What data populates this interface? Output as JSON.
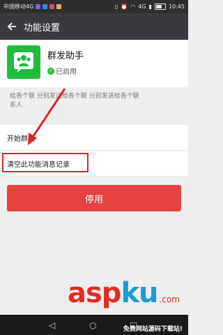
{
  "statusbar": {
    "carrier": "中国移动4G",
    "network": "4G",
    "time": "10:45"
  },
  "header": {
    "back_icon": "arrow-left-icon",
    "title": "功能设置"
  },
  "app": {
    "icon": "group-users-icon",
    "icon_color": "#1fbd3a",
    "name": "群发助手",
    "status": "已启用"
  },
  "description": {
    "line1": "给各个联    分别发送给各个联    分别发送给各个联",
    "line2": "系人"
  },
  "menu": [
    {
      "label": "开始群发"
    },
    {
      "label": "清空此功能消息记录"
    }
  ],
  "stop_button": {
    "label": "停用",
    "color": "#e64340"
  },
  "watermark": {
    "brand_a": "asp",
    "brand_b": "ku",
    "suffix": ".com",
    "tagline": "免费网站源码下载站!"
  },
  "annotation_color": "#d9262c"
}
